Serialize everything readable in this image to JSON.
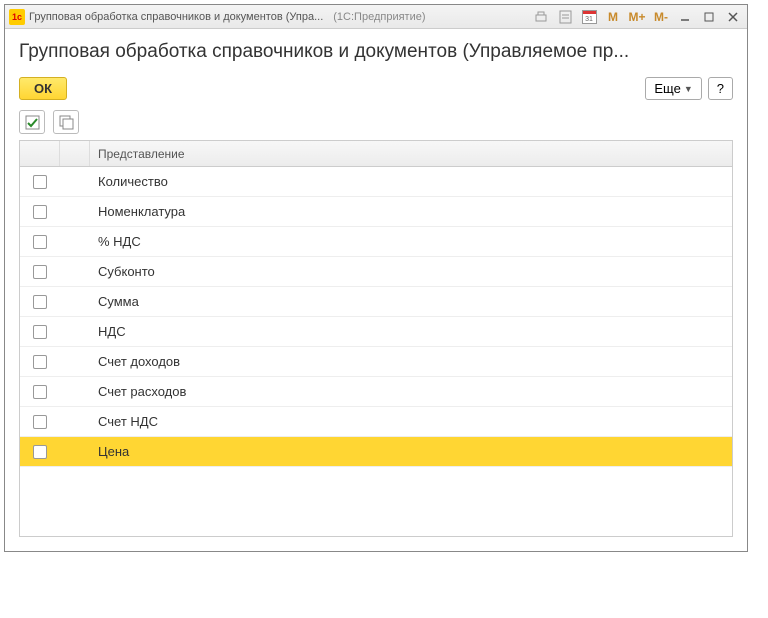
{
  "window": {
    "title": "Групповая обработка справочников и документов (Упра...",
    "subtitle": "(1С:Предприятие)"
  },
  "page_title": "Групповая обработка справочников и документов (Управляемое пр...",
  "toolbar": {
    "ok_label": "ОК",
    "more_label": "Еще",
    "help_label": "?"
  },
  "table": {
    "header": "Представление",
    "rows": [
      {
        "label": "Количество",
        "checked": false,
        "selected": false
      },
      {
        "label": "Номенклатура",
        "checked": false,
        "selected": false
      },
      {
        "label": "% НДС",
        "checked": false,
        "selected": false
      },
      {
        "label": "Субконто",
        "checked": false,
        "selected": false
      },
      {
        "label": "Сумма",
        "checked": false,
        "selected": false
      },
      {
        "label": "НДС",
        "checked": false,
        "selected": false
      },
      {
        "label": "Счет доходов",
        "checked": false,
        "selected": false
      },
      {
        "label": "Счет расходов",
        "checked": false,
        "selected": false
      },
      {
        "label": "Счет НДС",
        "checked": false,
        "selected": false
      },
      {
        "label": "Цена",
        "checked": false,
        "selected": true
      }
    ]
  },
  "titlebar_icons": {
    "m1": "M",
    "m2": "M+",
    "m3": "M-",
    "cal_day": "31"
  }
}
